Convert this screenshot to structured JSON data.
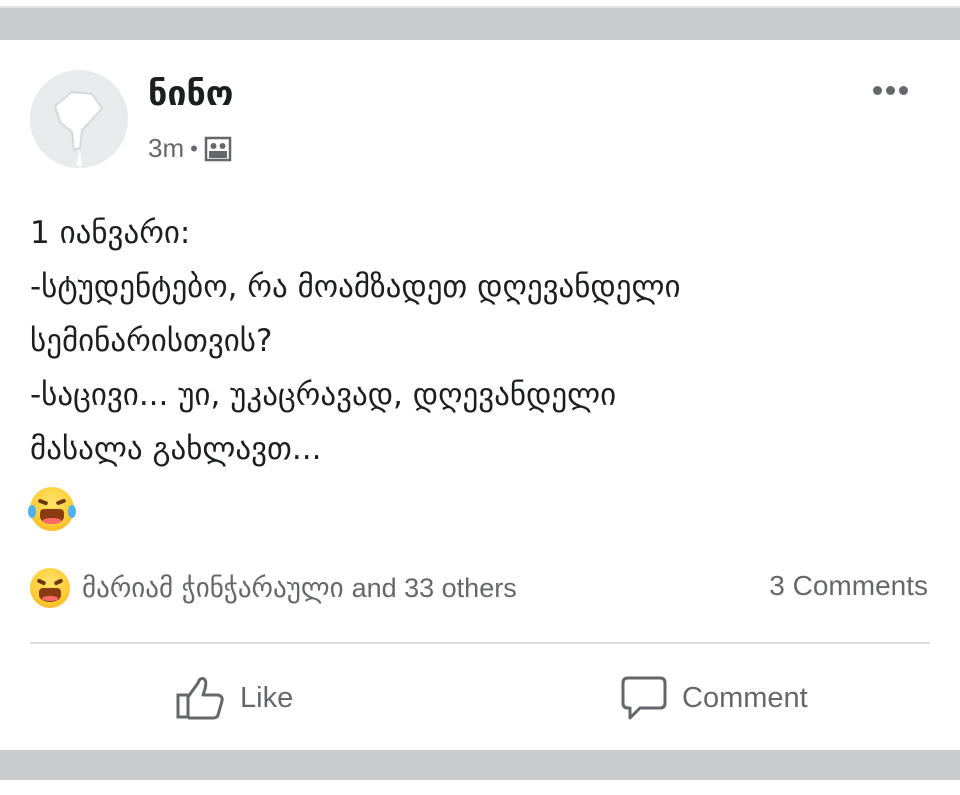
{
  "post": {
    "author": "ნინო",
    "time": "3m",
    "privacy_icon": "group-icon",
    "lines": [
      "1 იანვარი:",
      "-სტუდენტებო, რა მოამზადეთ დღევანდელი",
      "სემინარისთვის?",
      "-საცივი... უი, უკაცრავად, დღევანდელი",
      "მასალა გახლავთ..."
    ],
    "emoji": "laughing-with-tears-emoji"
  },
  "reactions": {
    "emoji": "laughing-reaction-icon",
    "names": "მარიამ ჭინჭარაული",
    "count_text": "and 33 others",
    "comments": "3 Comments"
  },
  "actions": {
    "like_label": "Like",
    "comment_label": "Comment"
  },
  "colors": {
    "text": "#1c1e21",
    "secondary": "#65676b",
    "band": "#c9cbcf"
  }
}
